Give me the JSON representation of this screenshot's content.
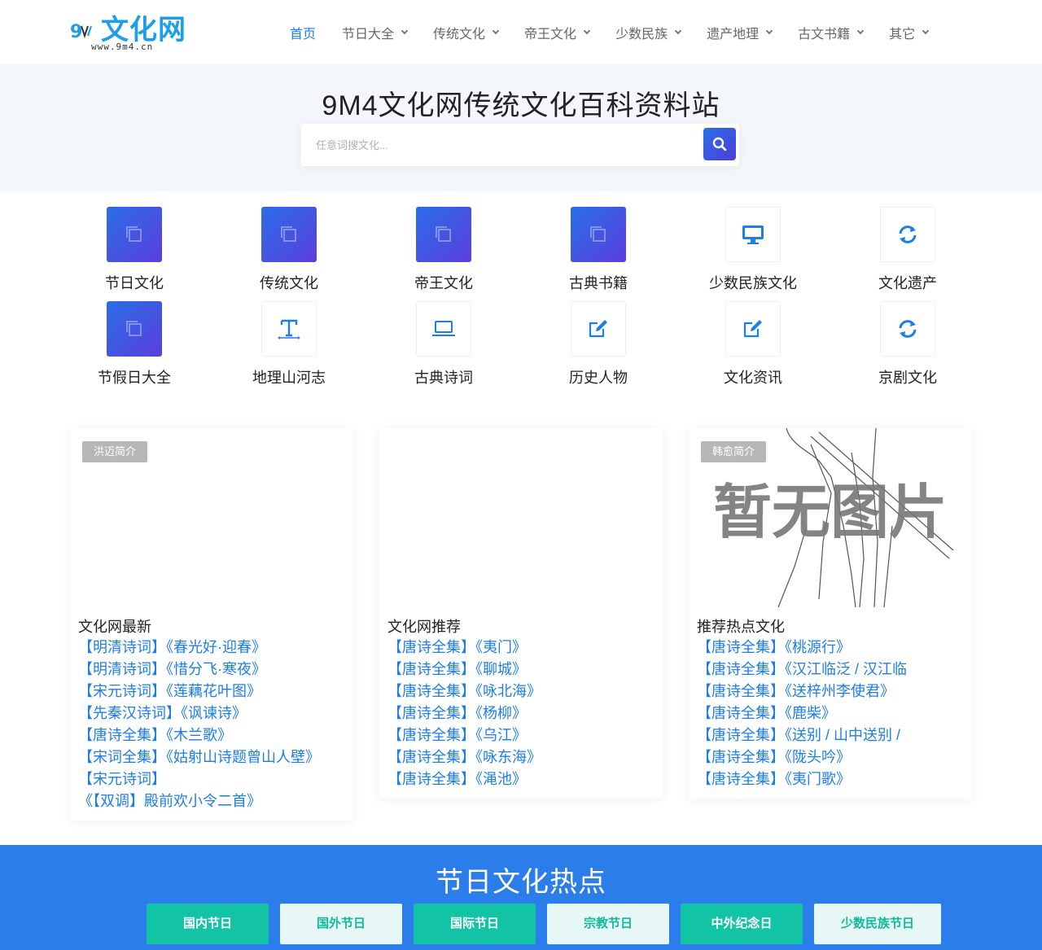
{
  "header": {
    "logo_text": "文化网",
    "logo_sub": "www.9m4.cn",
    "nav": [
      {
        "label": "首页",
        "active": true,
        "dropdown": false
      },
      {
        "label": "节日大全",
        "active": false,
        "dropdown": true
      },
      {
        "label": "传统文化",
        "active": false,
        "dropdown": true
      },
      {
        "label": "帝王文化",
        "active": false,
        "dropdown": true
      },
      {
        "label": "少数民族",
        "active": false,
        "dropdown": true
      },
      {
        "label": "遗产地理",
        "active": false,
        "dropdown": true
      },
      {
        "label": "古文书籍",
        "active": false,
        "dropdown": true
      },
      {
        "label": "其它",
        "active": false,
        "dropdown": true
      }
    ]
  },
  "hero": {
    "title": "9M4文化网传统文化百科资料站",
    "search_placeholder": "任意词搜文化..."
  },
  "categories": [
    {
      "label": "节日文化",
      "icon": "copy-icon",
      "style": "grad"
    },
    {
      "label": "传统文化",
      "icon": "copy-icon",
      "style": "grad"
    },
    {
      "label": "帝王文化",
      "icon": "copy-icon",
      "style": "grad"
    },
    {
      "label": "古典书籍",
      "icon": "copy-icon",
      "style": "grad"
    },
    {
      "label": "少数民族文化",
      "icon": "monitor-icon",
      "style": "plain"
    },
    {
      "label": "文化遗产",
      "icon": "refresh-icon",
      "style": "plain"
    },
    {
      "label": "节假日大全",
      "icon": "copy-icon",
      "style": "grad"
    },
    {
      "label": "地理山河志",
      "icon": "text-icon",
      "style": "plain"
    },
    {
      "label": "古典诗词",
      "icon": "laptop-icon",
      "style": "plain"
    },
    {
      "label": "历史人物",
      "icon": "edit-icon",
      "style": "plain"
    },
    {
      "label": "文化资讯",
      "icon": "edit-icon",
      "style": "plain"
    },
    {
      "label": "京剧文化",
      "icon": "refresh-icon",
      "style": "plain"
    }
  ],
  "cards": [
    {
      "badge": "洪迈简介",
      "image_text": "",
      "title": "文化网最新",
      "items": [
        {
          "tag": "【明清诗词】",
          "text": "《春光好·迎春》"
        },
        {
          "tag": "【明清诗词】",
          "text": "《惜分飞·寒夜》"
        },
        {
          "tag": "【宋元诗词】",
          "text": "《莲藕花叶图》"
        },
        {
          "tag": "【先秦汉诗词】",
          "text": "《讽谏诗》"
        },
        {
          "tag": "【唐诗全集】",
          "text": "《木兰歌》"
        },
        {
          "tag": "【宋词全集】",
          "text": "《姑射山诗题曾山人壁》"
        },
        {
          "tag": "【宋元诗词】",
          "text": "《【双调】殿前欢小令二首》"
        }
      ]
    },
    {
      "badge": "",
      "image_text": "",
      "title": "文化网推荐",
      "items": [
        {
          "tag": "【唐诗全集】",
          "text": "《夷门》"
        },
        {
          "tag": "【唐诗全集】",
          "text": "《聊城》"
        },
        {
          "tag": "【唐诗全集】",
          "text": "《咏北海》"
        },
        {
          "tag": "【唐诗全集】",
          "text": "《杨柳》"
        },
        {
          "tag": "【唐诗全集】",
          "text": "《乌江》"
        },
        {
          "tag": "【唐诗全集】",
          "text": "《咏东海》"
        },
        {
          "tag": "【唐诗全集】",
          "text": "《渑池》"
        }
      ]
    },
    {
      "badge": "韩愈简介",
      "image_text": "暂无图片",
      "title": "推荐热点文化",
      "items": [
        {
          "tag": "【唐诗全集】",
          "text": "《桃源行》"
        },
        {
          "tag": "【唐诗全集】",
          "text": "《汉江临泛 / 汉江临"
        },
        {
          "tag": "【唐诗全集】",
          "text": "《送梓州李使君》"
        },
        {
          "tag": "【唐诗全集】",
          "text": "《鹿柴》"
        },
        {
          "tag": "【唐诗全集】",
          "text": "《送别 / 山中送别 /"
        },
        {
          "tag": "【唐诗全集】",
          "text": "《陇头吟》"
        },
        {
          "tag": "【唐诗全集】",
          "text": "《夷门歌》"
        }
      ]
    }
  ],
  "hot": {
    "title": "节日文化热点",
    "tabs": [
      {
        "label": "国内节日",
        "style": "dark"
      },
      {
        "label": "国外节日",
        "style": "light"
      },
      {
        "label": "国际节日",
        "style": "dark"
      },
      {
        "label": "宗教节日",
        "style": "light"
      },
      {
        "label": "中外纪念日",
        "style": "dark"
      },
      {
        "label": "少数民族节日",
        "style": "light"
      }
    ]
  },
  "colors": {
    "accent": "#1d7ee8",
    "brand": "#1d9ee8",
    "section_blue": "#2b7de9",
    "tab_teal": "#12c3a6"
  }
}
